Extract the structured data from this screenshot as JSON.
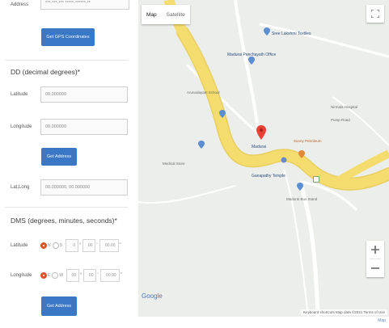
{
  "form": {
    "address_label": "Address",
    "address_value": "***-***-*** *****-******-**",
    "gps_button": "Get GPS Coordinates",
    "dd_title": "DD (decimal degrees)*",
    "latitude_label": "Latitude",
    "latitude_value": "00.000000",
    "longitude_label": "Longitude",
    "longitude_value": "00.000000",
    "get_address_button": "Get Address",
    "latlong_label": "Lat,Long",
    "latlong_value": "00.000000, 00.000000",
    "dms_title": "DMS (degrees, minutes, seconds)*",
    "dms_lat_label": "Latitude",
    "dms_lat_n": "N",
    "dms_lat_s": "S",
    "dms_lat_deg": "0",
    "dms_lat_min": "00",
    "dms_lat_sec": "00.00",
    "dms_lng_label": "Longitude",
    "dms_lng_e": "E",
    "dms_lng_w": "W",
    "dms_lng_deg": "00",
    "dms_lng_min": "00",
    "dms_lng_sec": "00.00",
    "deg_symbol": "°",
    "min_symbol": "'",
    "sec_symbol": "\"",
    "get_address_button_2": "Get Address"
  },
  "map": {
    "map_label": "Map",
    "satellite_label": "Satellite",
    "google_logo": "Google",
    "attribution": "Keyboard shortcuts   Map data ©2021   Terms of Use",
    "footer_link": "Map",
    "places": [
      "Sree Lakshmi Textiles",
      "Madurai Panchayath Office",
      "Arunodayam School",
      "Nirmala Hospital",
      "Sunny Petroleum",
      "Medical Store",
      "Madurai",
      "Ganapathy Temple",
      "Madurai Bus Stand",
      "Pump Road"
    ]
  },
  "colors": {
    "button_blue": "#3a78c6",
    "road_yellow": "#f5dc6e",
    "radio_active": "#e0522a",
    "pin_red": "#e94235"
  }
}
